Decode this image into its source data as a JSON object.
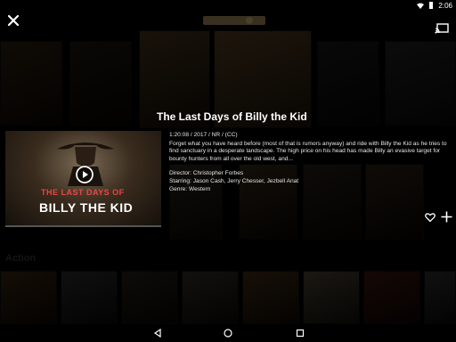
{
  "status_bar": {
    "time": "2:06"
  },
  "section_label": "Action",
  "detail": {
    "title": "The Last Days of Billy the Kid",
    "hero_title_top": "THE LAST DAYS OF",
    "hero_title_bottom": "BILLY THE KID",
    "meta": "1:20:08 / 2017 / NR / (CC)",
    "description": "Forget what you have heard before (most of that is rumors anyway) and ride with Billy the Kid as he tries to find sanctuary in a desperate landscape. The high price on his head has made Billy an evasive target for bounty hunters from all over the old west, and...",
    "director": "Director: Christopher Forbes",
    "starring": "Starring: Jason Cash, Jerry Chesser, Jezbell Anat",
    "genre": "Genre: Western"
  },
  "colors": {
    "background": "#000000",
    "text": "#ffffff",
    "hero_title_accent": "#e44444"
  },
  "icons": {
    "close": "close-icon",
    "cast": "cast-icon",
    "play": "play-icon",
    "favorite": "heart-icon",
    "add": "plus-icon",
    "back": "back-icon",
    "home": "home-icon",
    "recent": "recent-apps-icon",
    "wifi": "wifi-icon",
    "battery": "battery-icon"
  }
}
